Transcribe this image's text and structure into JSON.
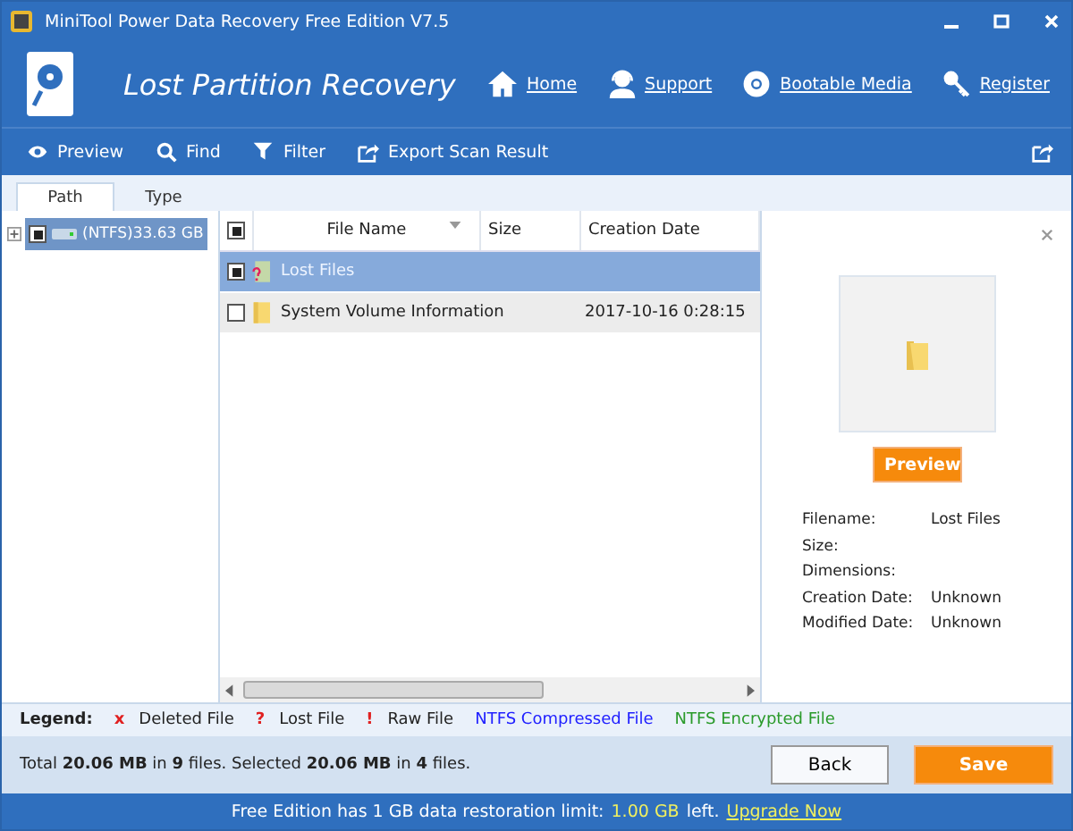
{
  "window": {
    "title": "MiniTool Power Data Recovery Free Edition V7.5"
  },
  "header": {
    "title": "Lost Partition Recovery",
    "links": [
      {
        "kind": "home",
        "label": "Home"
      },
      {
        "kind": "support",
        "label": "Support"
      },
      {
        "kind": "media",
        "label": "Bootable Media"
      },
      {
        "kind": "register",
        "label": "Register"
      }
    ]
  },
  "toolbar": [
    {
      "kind": "preview",
      "label": "Preview"
    },
    {
      "kind": "find",
      "label": "Find"
    },
    {
      "kind": "filter",
      "label": "Filter"
    },
    {
      "kind": "export",
      "label": "Export Scan Result"
    }
  ],
  "tabs": [
    {
      "label": "Path",
      "selected": true
    },
    {
      "label": "Type",
      "selected": false
    }
  ],
  "tree": [
    {
      "label": "(NTFS)33.63 GB",
      "checked": true,
      "selected": true,
      "expanded": false
    }
  ],
  "table": {
    "columns": [
      "File Name",
      "Size",
      "Creation Date"
    ],
    "all_checked": true,
    "rows": [
      {
        "kind": "lost",
        "name": "Lost Files",
        "checked": true,
        "selected": true
      },
      {
        "kind": "folder",
        "name": "System Volume Information",
        "created": "2017-10-16 0:28:15",
        "checked": false,
        "selected": false
      }
    ]
  },
  "preview": {
    "button": "Preview",
    "fields": [
      {
        "label": "Filename:",
        "value": "Lost Files"
      },
      {
        "label": "Size:"
      },
      {
        "label": "Dimensions:"
      },
      {
        "label": "Creation Date:",
        "value": "Unknown"
      },
      {
        "label": "Modified Date:",
        "value": "Unknown"
      }
    ]
  },
  "legend": {
    "title": "Legend:",
    "items": [
      {
        "mark": "x",
        "label": "Deleted File",
        "color": "#e02020"
      },
      {
        "mark": "?",
        "label": "Lost File",
        "color": "#e02020"
      },
      {
        "mark": "!",
        "label": "Raw File",
        "color": "#e02020"
      },
      {
        "label": "NTFS Compressed File",
        "color": "#2020ff"
      },
      {
        "label": "NTFS Encrypted File",
        "color": "#2a9a2a"
      }
    ]
  },
  "status": "Total **20.06 MB** in **9** files.  Selected **20.06 MB** in **4** files.",
  "buttons": [
    {
      "kind": "back",
      "label": "Back"
    },
    {
      "kind": "save",
      "label": "Save"
    }
  ],
  "footer": {
    "text": "Free Edition has 1 GB data restoration limit:",
    "highlight": "1.00 GB",
    "suffix": "left.",
    "link": "Upgrade Now"
  }
}
